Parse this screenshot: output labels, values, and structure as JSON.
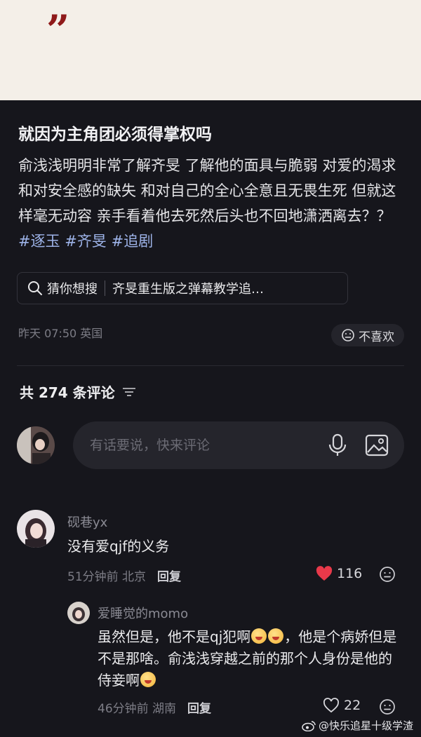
{
  "post": {
    "quote_mark": "”",
    "title": "就因为主角团必须得掌权吗",
    "body": "俞浅浅明明非常了解齐旻 了解他的面具与脆弱 对爱的渴求和对安全感的缺失 和对自己的全心全意且无畏生死 但就这样毫无动容 亲手看着他去死然后头也不回地潇洒离去？？",
    "hashtags": [
      "#逐玉",
      "#齐旻",
      "#追剧"
    ],
    "search_label": "猜你想搜",
    "search_suggestion": "齐旻重生版之弹幕教学追…",
    "meta": "昨天 07:50  英国",
    "dislike_label": "不喜欢"
  },
  "comments_header": {
    "count_label": "共 274 条评论"
  },
  "composer": {
    "placeholder": "有话要说，快来评论",
    "mic_icon": "microphone-icon",
    "image_icon": "image-icon"
  },
  "comments": [
    {
      "user": "砚巷yx",
      "text": "没有爱qjf的义务",
      "time_location": "51分钟前  北京",
      "reply_label": "回复",
      "likes": "116",
      "liked": true
    }
  ],
  "replies": [
    {
      "user": "爱睡觉的momo",
      "text_parts": [
        "虽然但是，他不是qj犯啊",
        "，他是个病娇但是不是那啥。俞浅浅穿越之前的那个人身份是他的侍妾啊"
      ],
      "time_location": "46分钟前  湖南",
      "reply_label": "回复",
      "likes": "22",
      "liked": false
    }
  ],
  "watermark": "@快乐追星十级学渣",
  "colors": {
    "accent_like": "#e8394a",
    "hashtag": "#9db3e8",
    "background": "#16161c"
  }
}
